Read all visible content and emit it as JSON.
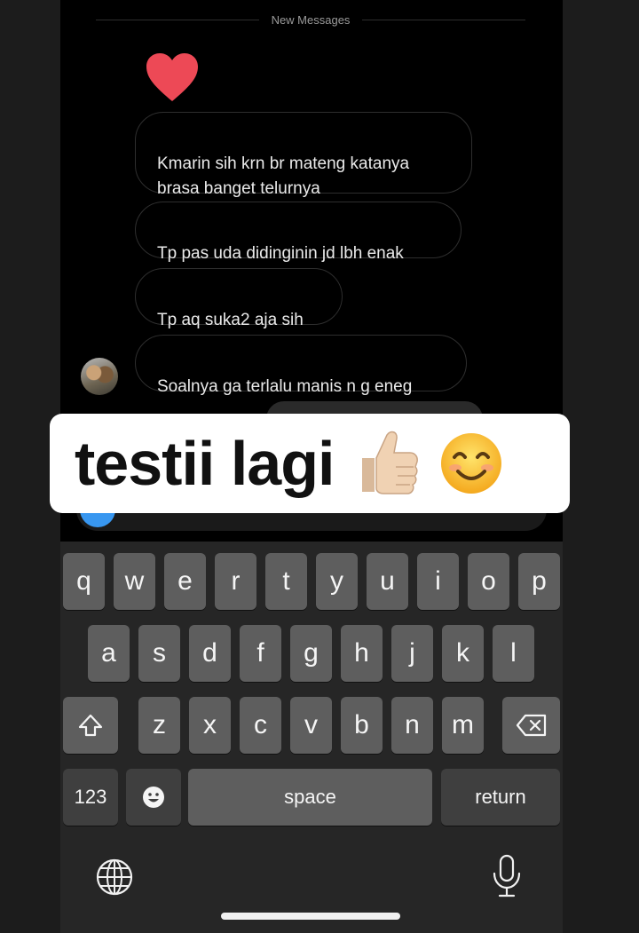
{
  "chat": {
    "divider_label": "New Messages",
    "messages": [
      {
        "text": "Kmarin sih krn br mateng katanya\nbrasa banget telurnya"
      },
      {
        "text": "Tp pas uda didinginin jd lbh enak"
      },
      {
        "text": "Tp aq suka2 aja sih"
      },
      {
        "text": "Soalnya ga terlalu manis n g eneg"
      }
    ],
    "reaction_icon": "heart-icon"
  },
  "sticker": {
    "text": "testii lagi",
    "emoji": [
      "thumbs-up",
      "smiling-face"
    ]
  },
  "keyboard": {
    "row1": [
      "q",
      "w",
      "e",
      "r",
      "t",
      "y",
      "u",
      "i",
      "o",
      "p"
    ],
    "row2": [
      "a",
      "s",
      "d",
      "f",
      "g",
      "h",
      "j",
      "k",
      "l"
    ],
    "row3": [
      "z",
      "x",
      "c",
      "v",
      "b",
      "n",
      "m"
    ],
    "numbers_label": "123",
    "space_label": "space",
    "return_label": "return"
  },
  "colors": {
    "heart": "#ed4956",
    "key": "#5e5e5e",
    "key_dark": "#3f3f3f",
    "accent": "#3897f0"
  }
}
